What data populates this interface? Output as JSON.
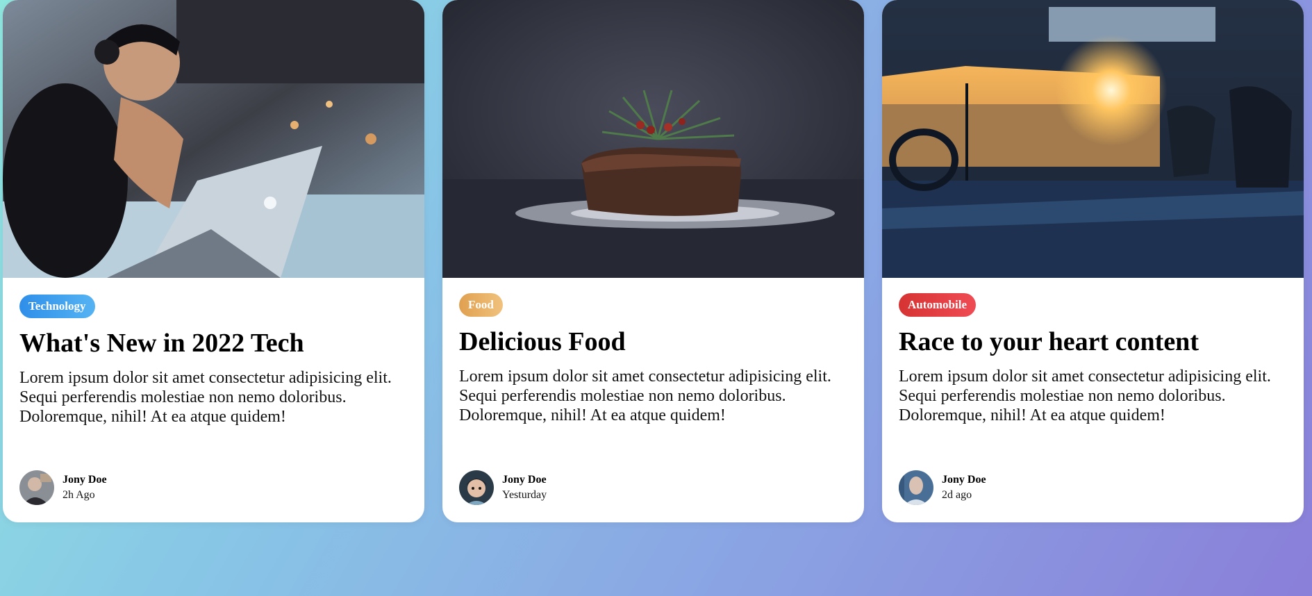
{
  "cards": [
    {
      "image": "person-laptop-photo",
      "tag": "Technology",
      "title": "What's New in 2022 Tech",
      "excerpt": "Lorem ipsum dolor sit amet consectetur adipisicing elit. Sequi perferendis molestiae non nemo doloribus. Doloremque, nihil! At ea atque quidem!",
      "author": {
        "name": "Jony Doe",
        "time": "2h Ago",
        "avatar": "avatar-man-photo"
      }
    },
    {
      "image": "cake-photo",
      "tag": "Food",
      "title": "Delicious Food",
      "excerpt": "Lorem ipsum dolor sit amet consectetur adipisicing elit. Sequi perferendis molestiae non nemo doloribus. Doloremque, nihil! At ea atque quidem!",
      "author": {
        "name": "Jony Doe",
        "time": "Yesturday",
        "avatar": "avatar-child-photo"
      }
    },
    {
      "image": "car-interior-photo",
      "tag": "Automobile",
      "title": "Race to your heart content",
      "excerpt": "Lorem ipsum dolor sit amet consectetur adipisicing elit. Sequi perferendis molestiae non nemo doloribus. Doloremque, nihil! At ea atque quidem!",
      "author": {
        "name": "Jony Doe",
        "time": "2d ago",
        "avatar": "avatar-bald-man-photo"
      }
    }
  ],
  "colors": {
    "tech_tag": "#3a9cee",
    "food_tag": "#e8ad63",
    "auto_tag": "#e0404a",
    "card_bg": "#ffffff"
  }
}
